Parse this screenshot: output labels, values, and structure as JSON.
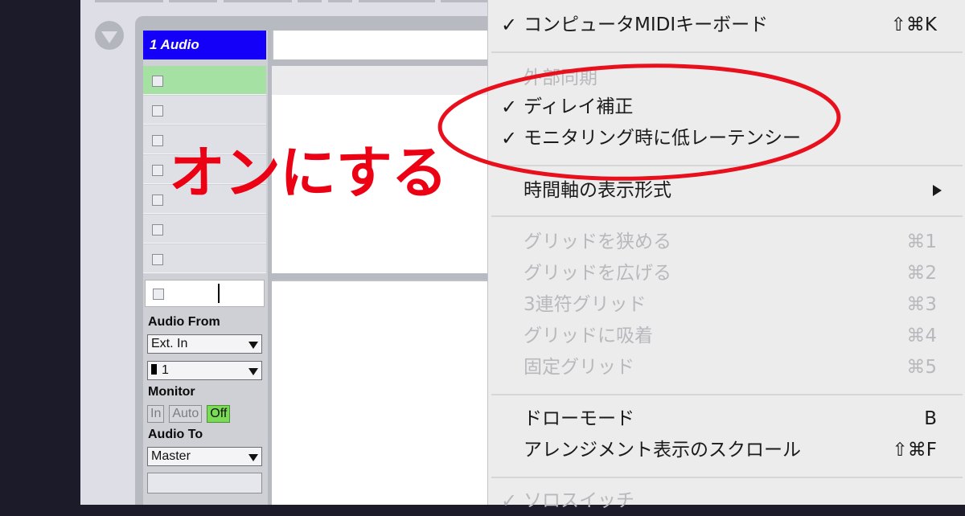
{
  "track": {
    "name": "1 Audio",
    "input_section": {
      "audio_from_label": "Audio From",
      "input_type": "Ext. In",
      "input_channel": "1",
      "monitor_label": "Monitor",
      "monitor_options": [
        "In",
        "Auto",
        "Off"
      ],
      "monitor_selected": "Off",
      "audio_to_label": "Audio To",
      "output": "Master"
    }
  },
  "annotation": {
    "callout": "オンにする"
  },
  "options_menu": {
    "items": [
      {
        "label": "コンピュータMIDIキーボード",
        "shortcut": "⇧⌘K",
        "checked": true,
        "enabled": true
      },
      {
        "label": "外部同期",
        "header": true
      },
      {
        "label": "ディレイ補正",
        "checked": true,
        "enabled": true
      },
      {
        "label": "モニタリング時に低レーテンシー",
        "checked": true,
        "enabled": true
      },
      {
        "label": "時間軸の表示形式",
        "submenu": true,
        "enabled": true
      },
      {
        "label": "グリッドを狭める",
        "shortcut": "⌘1",
        "enabled": false
      },
      {
        "label": "グリッドを広げる",
        "shortcut": "⌘2",
        "enabled": false
      },
      {
        "label": "3連符グリッド",
        "shortcut": "⌘3",
        "enabled": false
      },
      {
        "label": "グリッドに吸着",
        "shortcut": "⌘4",
        "enabled": false
      },
      {
        "label": "固定グリッド",
        "shortcut": "⌘5",
        "enabled": false
      },
      {
        "label": "ドローモード",
        "shortcut": "B",
        "enabled": true
      },
      {
        "label": "アレンジメント表示のスクロール",
        "shortcut": "⇧⌘F",
        "enabled": true
      },
      {
        "label": "ソロスイッチ",
        "checked": true,
        "enabled": false
      }
    ]
  },
  "colors": {
    "track_title_bg": "#1400f8",
    "active_slot": "#a6e1a4",
    "monitor_off_active": "#7adb57",
    "annotation_red": "#ec0014",
    "menu_bg": "#ececed"
  }
}
